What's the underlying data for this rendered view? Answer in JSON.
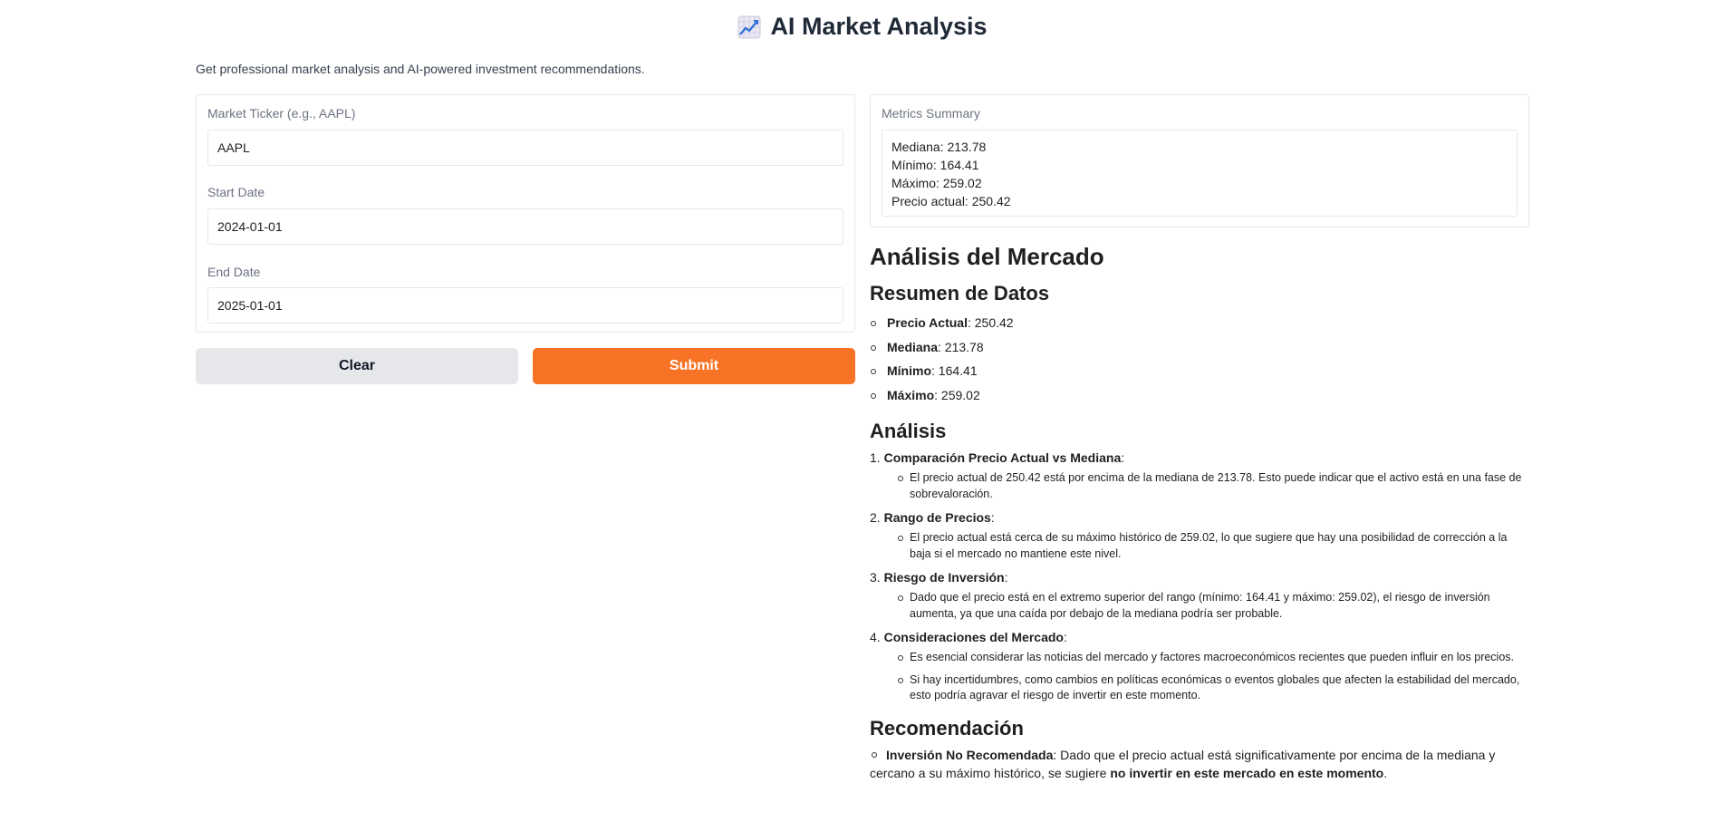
{
  "header": {
    "icon": "chart-increasing-icon",
    "title": "AI Market Analysis",
    "subtitle": "Get professional market analysis and AI-powered investment recommendations."
  },
  "form": {
    "ticker": {
      "label": "Market Ticker (e.g., AAPL)",
      "value": "AAPL"
    },
    "start_date": {
      "label": "Start Date",
      "value": "2024-01-01"
    },
    "end_date": {
      "label": "End Date",
      "value": "2025-01-01"
    },
    "clear_label": "Clear",
    "submit_label": "Submit"
  },
  "metrics": {
    "label": "Metrics Summary",
    "lines": [
      "Mediana: 213.78",
      "Mínimo: 164.41",
      "Máximo: 259.02",
      "Precio actual: 250.42"
    ]
  },
  "analysis": {
    "title": "Análisis del Mercado",
    "summary_heading": "Resumen de Datos",
    "summary": [
      {
        "key": "Precio Actual",
        "value": ": 250.42"
      },
      {
        "key": "Mediana",
        "value": ": 213.78"
      },
      {
        "key": "Mínimo",
        "value": ": 164.41"
      },
      {
        "key": "Máximo",
        "value": ": 259.02"
      }
    ],
    "analysis_heading": "Análisis",
    "points": [
      {
        "num": "1.",
        "title": "Comparación Precio Actual vs Mediana",
        "suffix": ":",
        "details": [
          "El precio actual de 250.42 está por encima de la mediana de 213.78. Esto puede indicar que el activo está en una fase de sobrevaloración."
        ]
      },
      {
        "num": "2.",
        "title": "Rango de Precios",
        "suffix": ":",
        "details": [
          "El precio actual está cerca de su máximo histórico de 259.02, lo que sugiere que hay una posibilidad de corrección a la baja si el mercado no mantiene este nivel."
        ]
      },
      {
        "num": "3.",
        "title": "Riesgo de Inversión",
        "suffix": ":",
        "details": [
          "Dado que el precio está en el extremo superior del rango (mínimo: 164.41 y máximo: 259.02), el riesgo de inversión aumenta, ya que una caída por debajo de la mediana podría ser probable."
        ]
      },
      {
        "num": "4.",
        "title": "Consideraciones del Mercado",
        "suffix": ":",
        "details": [
          "Es esencial considerar las noticias del mercado y factores macroeconómicos recientes que pueden influir en los precios.",
          "Si hay incertidumbres, como cambios en políticas económicas o eventos globales que afecten la estabilidad del mercado, esto podría agravar el riesgo de invertir en este momento."
        ]
      }
    ],
    "recommendation_heading": "Recomendación",
    "recommendation": {
      "bold": "Inversión No Recomendada",
      "text": ": Dado que el precio actual está significativamente por encima de la mediana y cercano a su máximo histórico, se sugiere ",
      "bold_end": "no invertir en este mercado en este momento",
      "end": "."
    }
  }
}
